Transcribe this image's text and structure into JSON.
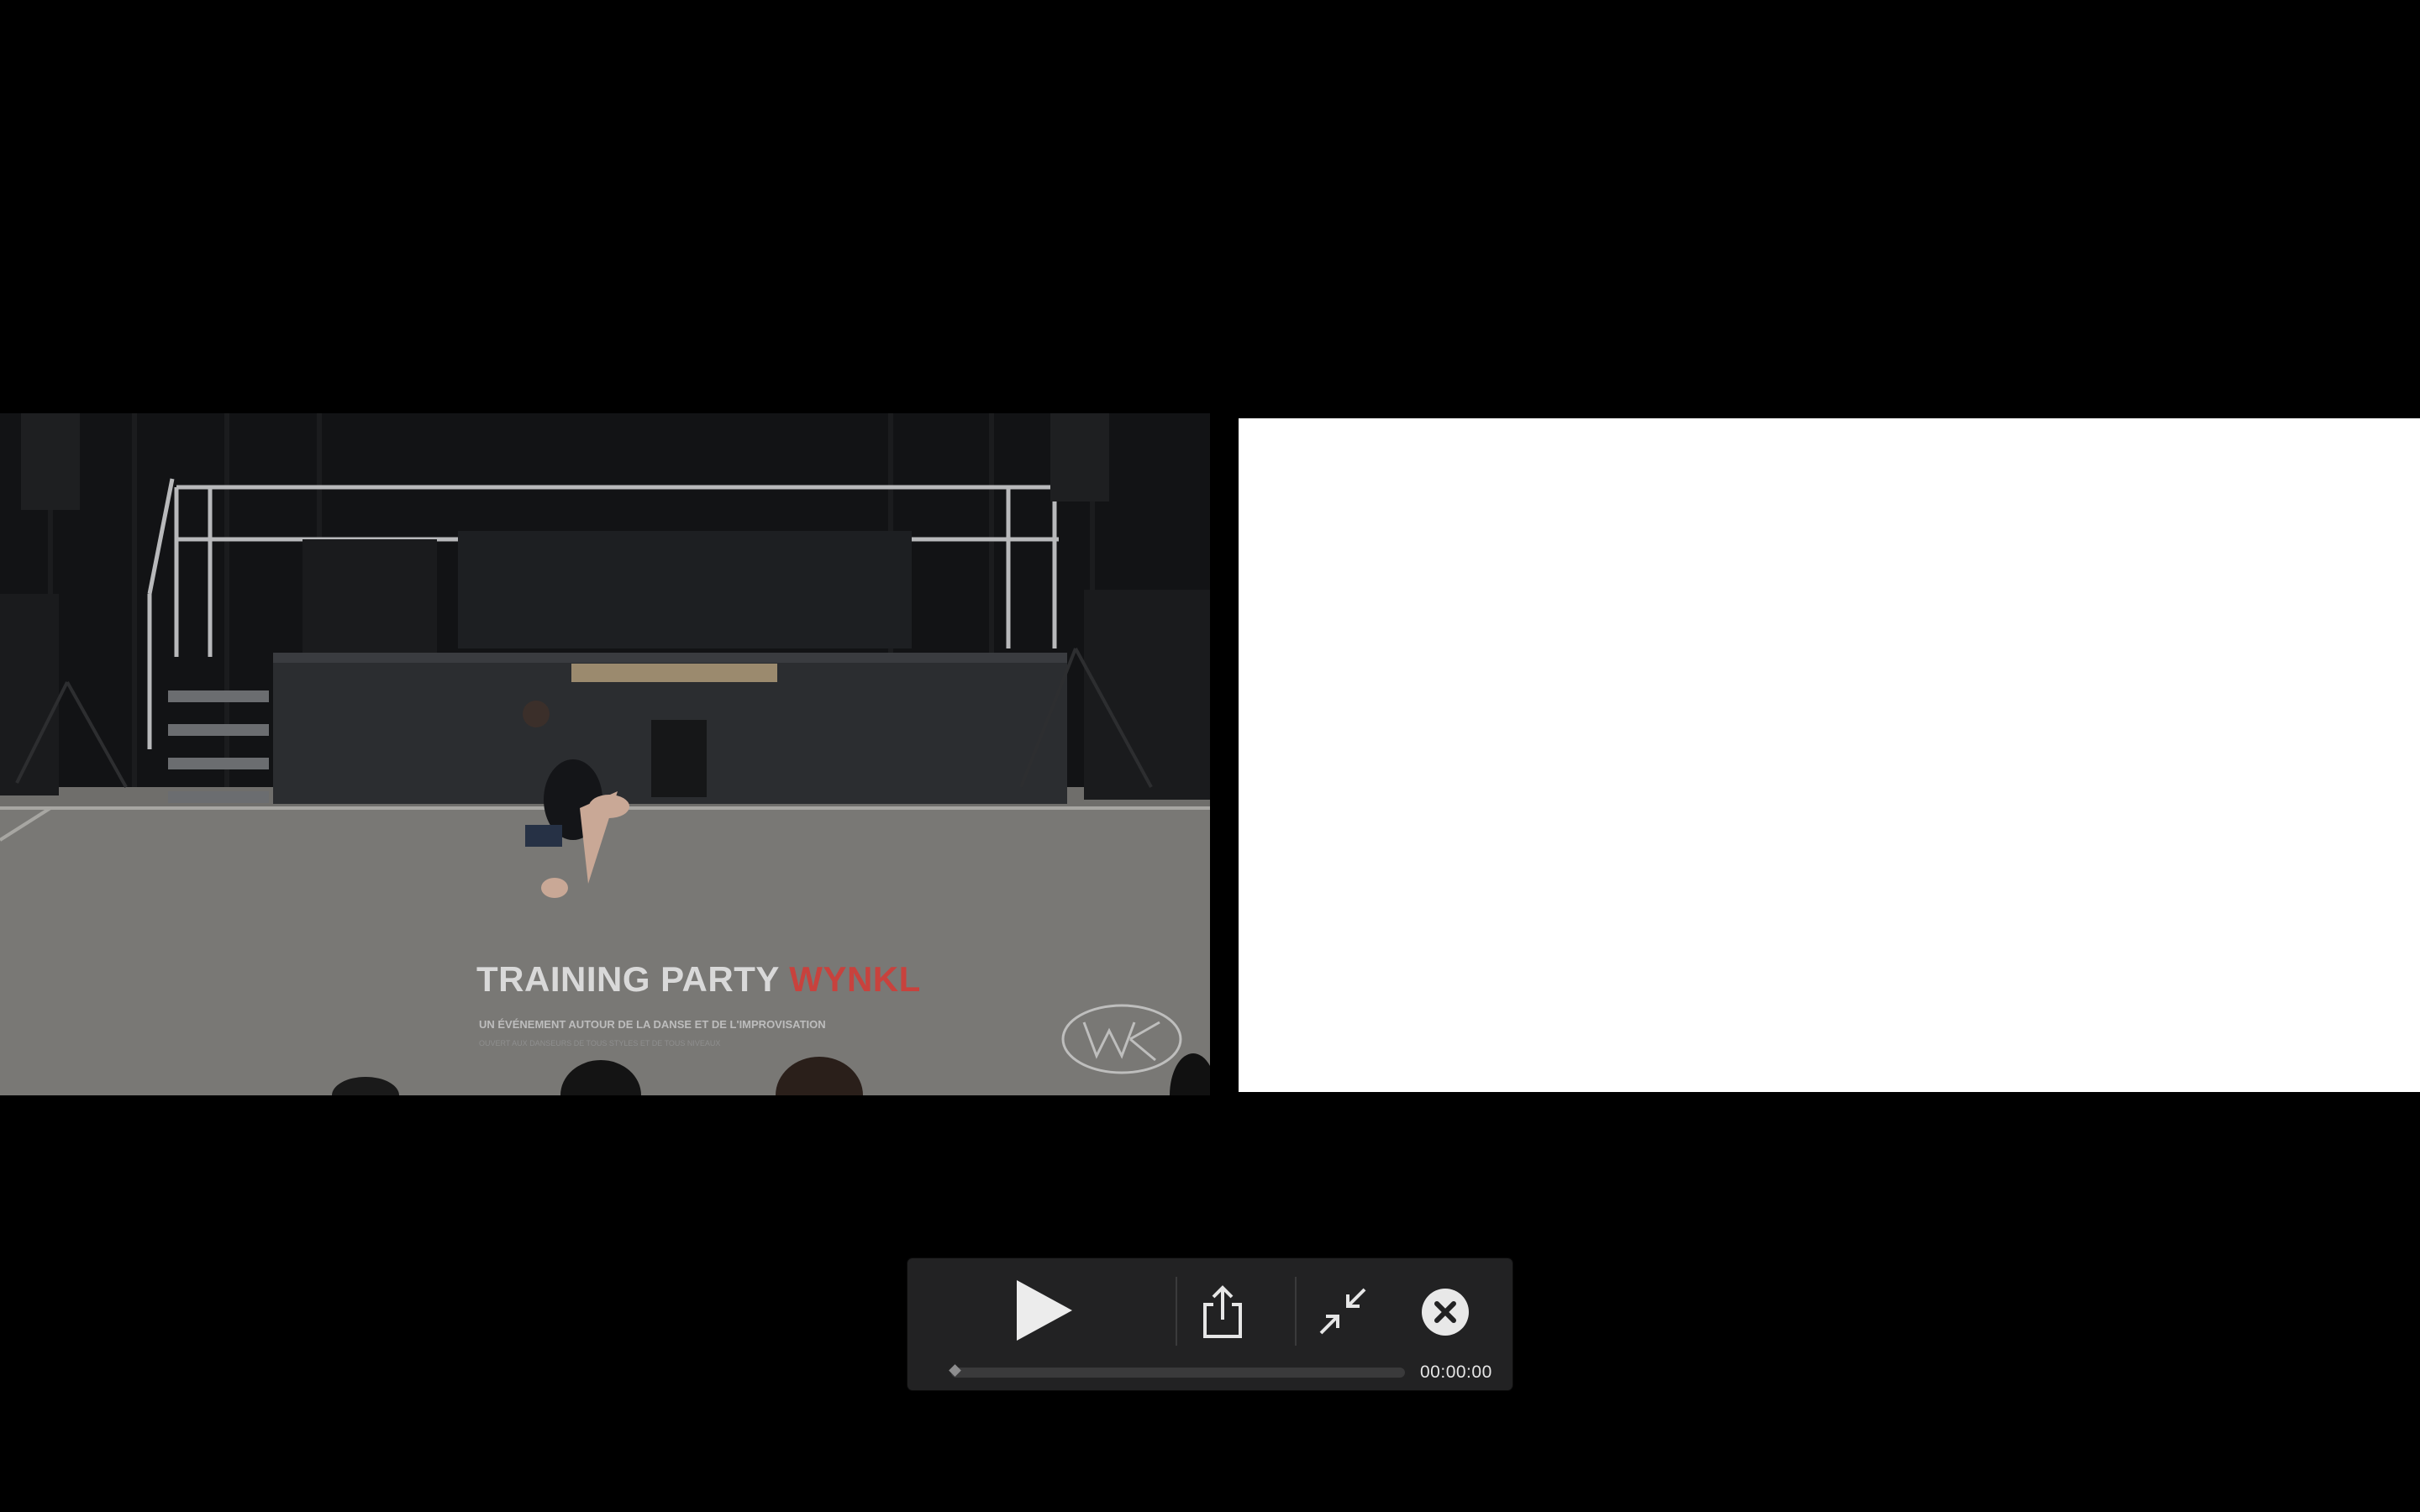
{
  "video": {
    "banner": {
      "title_main": "TRAINING PARTY",
      "title_brand": "WYNKL",
      "subtitle": "UN ÉVÉNEMENT AUTOUR DE LA DANSE ET DE L'IMPROVISATION",
      "subtitle_small": "OUVERT AUX DANSEURS DE TOUS STYLES ET DE TOUS NIVEAUX"
    },
    "watermark_text": "WYKL"
  },
  "controls": {
    "timecode": "00:00:00",
    "progress": 0.0,
    "icons": {
      "play": "play-icon",
      "share": "share-icon",
      "exit_fullscreen": "exit-fullscreen-icon",
      "close": "close-icon"
    }
  },
  "colors": {
    "background": "#000000",
    "hud": "#222223",
    "brand_red": "#c8423d",
    "panel_white": "#ffffff"
  }
}
